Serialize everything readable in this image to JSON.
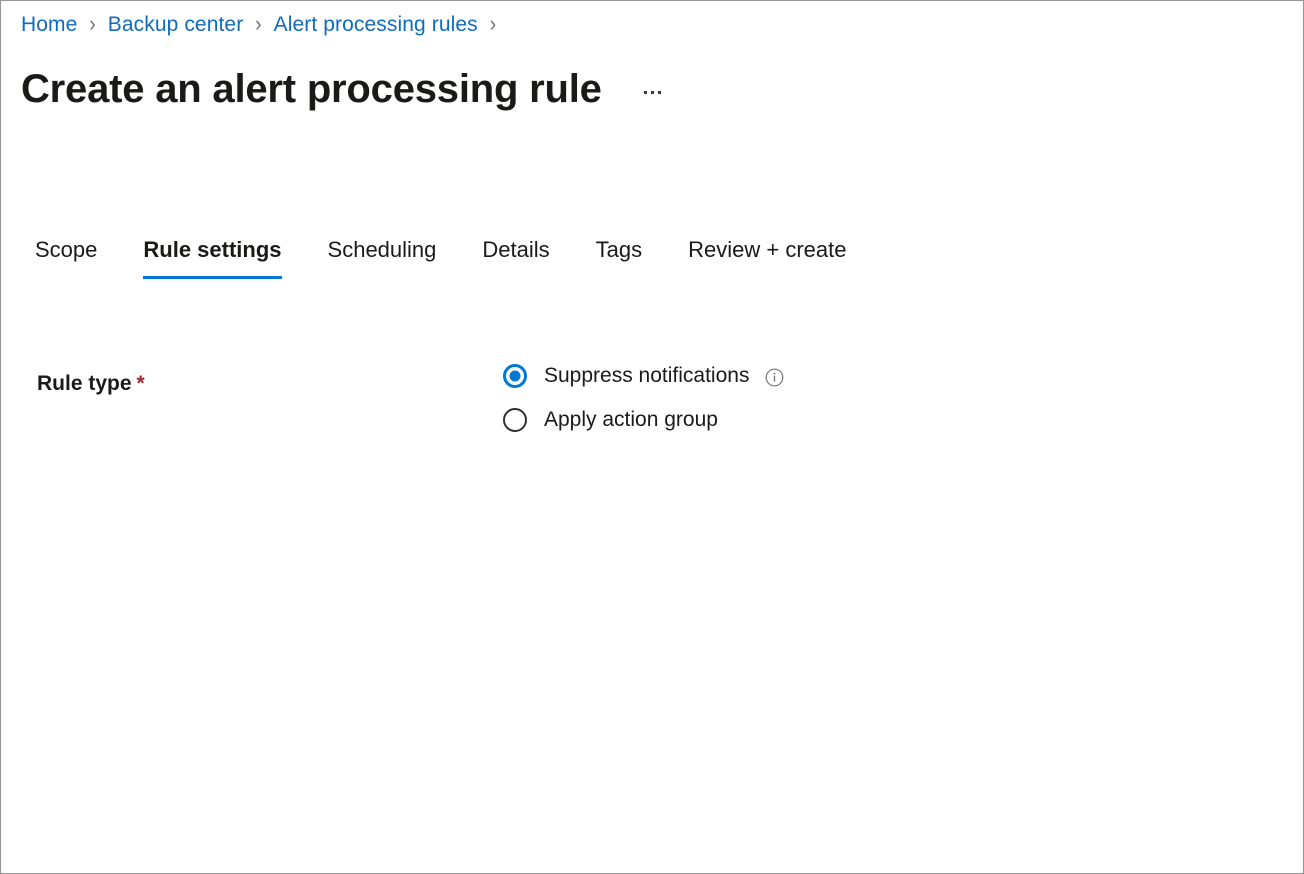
{
  "breadcrumb": {
    "name": "breadcrumb",
    "items": [
      {
        "label": "Home"
      },
      {
        "label": "Backup center"
      },
      {
        "label": "Alert processing rules"
      }
    ],
    "separator": "›",
    "trailing_separator": "›",
    "link_color": "#0f6cbd",
    "separator_color": "#6e6e6e"
  },
  "header": {
    "title": "Create an alert processing rule",
    "more_menu_label": "More commands",
    "more_menu_icon": "ellipsis-icon"
  },
  "tabs": {
    "active_index": 1,
    "items": [
      {
        "label": "Scope"
      },
      {
        "label": "Rule settings"
      },
      {
        "label": "Scheduling"
      },
      {
        "label": "Details"
      },
      {
        "label": "Tags"
      },
      {
        "label": "Review + create"
      }
    ],
    "active_underline_color": "#0078d4"
  },
  "form": {
    "rule_type": {
      "label": "Rule type",
      "required_marker": "*",
      "required_color": "#a4262c",
      "selected_value": "Suppress notifications",
      "options": [
        {
          "label": "Suppress notifications",
          "selected": true,
          "has_info_icon": true,
          "info_icon": "info-circle-icon"
        },
        {
          "label": "Apply action group",
          "selected": false,
          "has_info_icon": false,
          "info_icon": ""
        }
      ],
      "radio_selected_color": "#0078d4",
      "radio_unselected_color": "#323130"
    }
  }
}
